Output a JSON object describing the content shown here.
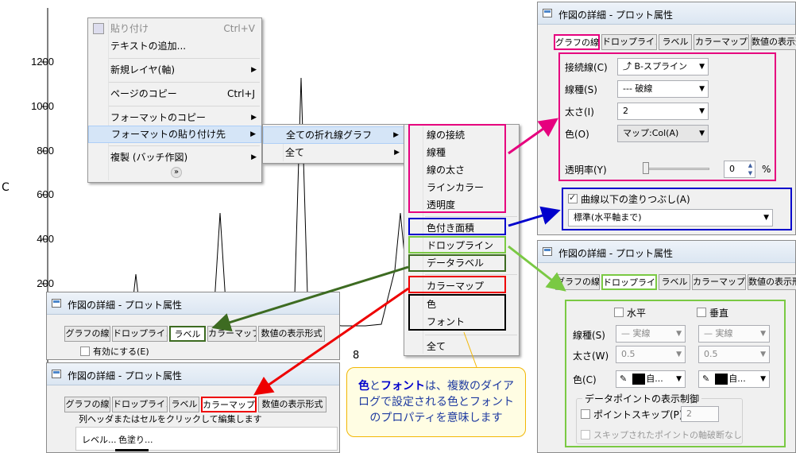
{
  "plot": {
    "y_ticks": [
      "1200",
      "1000",
      "800",
      "600",
      "400",
      "200"
    ],
    "y_axis_label": "C",
    "x_tick": "8"
  },
  "context_menu": {
    "items": [
      {
        "label": "貼り付け",
        "shortcut": "Ctrl+V",
        "disabled": true
      },
      {
        "label": "テキストの追加..."
      },
      {
        "label": "新規レイヤ(軸)",
        "submenu": true
      },
      {
        "label": "ページのコピー",
        "shortcut": "Ctrl+J"
      },
      {
        "label": "フォーマットのコピー",
        "submenu": true
      },
      {
        "label": "フォーマットの貼り付け先",
        "submenu": true,
        "highlighted": true
      },
      {
        "label": "複製 (バッチ作図)",
        "submenu": true
      }
    ],
    "expand_glyph": "»"
  },
  "submenu1": {
    "items": [
      {
        "label": "全ての折れ線グラフ",
        "highlighted": true
      },
      {
        "label": "全て"
      }
    ]
  },
  "submenu2": {
    "items": [
      "線の接続",
      "線種",
      "線の太さ",
      "ラインカラー",
      "透明度",
      "色付き面積",
      "ドロップライン",
      "データラベル",
      "カラーマップ",
      "色",
      "フォント",
      "全て"
    ]
  },
  "dialog_line": {
    "title": "作図の詳細 - プロット属性",
    "tabs": [
      "グラフの線",
      "ドロップライン",
      "ラベル",
      "カラーマップ",
      "数値の表示形"
    ],
    "connect_label": "接続線(C)",
    "connect_value": "B-スプライン",
    "style_label": "線種(S)",
    "style_value": "破線",
    "width_label": "太さ(I)",
    "width_value": "2",
    "color_label": "色(O)",
    "color_value": "マップ:Col(A)",
    "transparency_label": "透明率(Y)",
    "transparency_value": "0",
    "transparency_unit": "%",
    "transparency_percent": 0,
    "fill_label": "曲線以下の塗りつぶし(A)",
    "fill_value": "標準(水平軸まで)"
  },
  "dialog_drop": {
    "title": "作図の詳細 - プロット属性",
    "tabs": [
      "グラフの線",
      "ドロップライン",
      "ラベル",
      "カラーマップ",
      "数値の表示形"
    ],
    "horizontal_label": "水平",
    "vertical_label": "垂直",
    "style_label": "線種(S)",
    "style_value": "実線",
    "width_label": "太さ(W)",
    "width_value": "0.5",
    "color_label": "色(C)",
    "color_value": "自...",
    "group_label": "データポイントの表示制御",
    "skip_label": "ポイントスキップ(P)",
    "skip_value": "2",
    "skip_axis_break_label": "スキップされたポイントの軸破断なし"
  },
  "dialog_label": {
    "title": "作図の詳細 - プロット属性",
    "tabs": [
      "グラフの線",
      "ドロップライン",
      "ラベル",
      "カラーマップ",
      "数値の表示形式"
    ],
    "enable_label": "有効にする(E)"
  },
  "dialog_colormap": {
    "title": "作図の詳細 - プロット属性",
    "tabs": [
      "グラフの線",
      "ドロップライン",
      "ラベル",
      "カラーマップ",
      "数値の表示形式"
    ],
    "instruction": "列ヘッダまたはセルをクリックして編集します",
    "col_level": "レベル...",
    "col_fill": "色塗り..."
  },
  "callout": {
    "bold1": "色",
    "mid": "と",
    "bold2": "フォント",
    "rest1": "は、複数のダイア",
    "line2": "ログで設定される色とフォント",
    "line3": "のプロパティを意味します"
  },
  "colors": {
    "pink": "#e6007e",
    "blue": "#0000cc",
    "green": "#7ac943",
    "dark_green": "#3d6b21",
    "red": "#e00000",
    "callout_border": "#f2b705"
  }
}
